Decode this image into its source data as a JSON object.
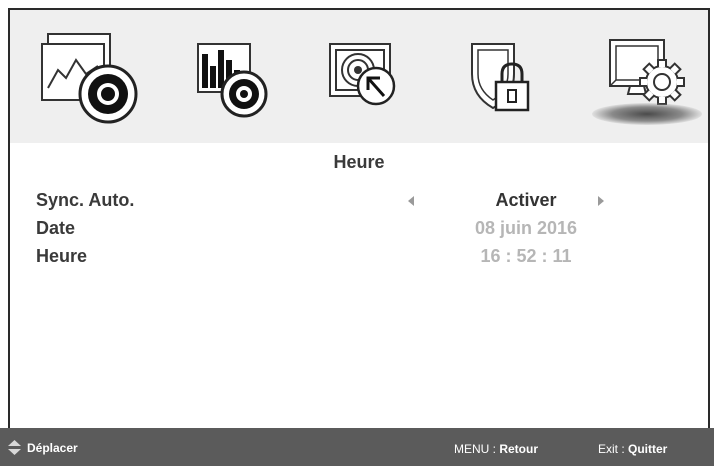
{
  "tabs": [
    {
      "icon": "picture-icon",
      "selected": false
    },
    {
      "icon": "color-icon",
      "selected": false
    },
    {
      "icon": "input-source-icon",
      "selected": false
    },
    {
      "icon": "lock-icon",
      "selected": false
    },
    {
      "icon": "settings-icon",
      "selected": true
    }
  ],
  "section": {
    "title": "Heure"
  },
  "settings": {
    "sync": {
      "label": "Sync. Auto.",
      "value": "Activer"
    },
    "date": {
      "label": "Date",
      "value": "08 juin 2016"
    },
    "time": {
      "label": "Heure",
      "value": "16 : 52 : 11"
    }
  },
  "footer": {
    "move_label": "Déplacer",
    "menu_key": "MENU : ",
    "menu_action": "Retour",
    "exit_key": "Exit : ",
    "exit_action": "Quitter"
  },
  "colors": {
    "topbar_bg": "#efefef",
    "footer_bg": "#5b5b5b",
    "text_active": "#333333",
    "text_disabled": "#b6b6b6"
  }
}
